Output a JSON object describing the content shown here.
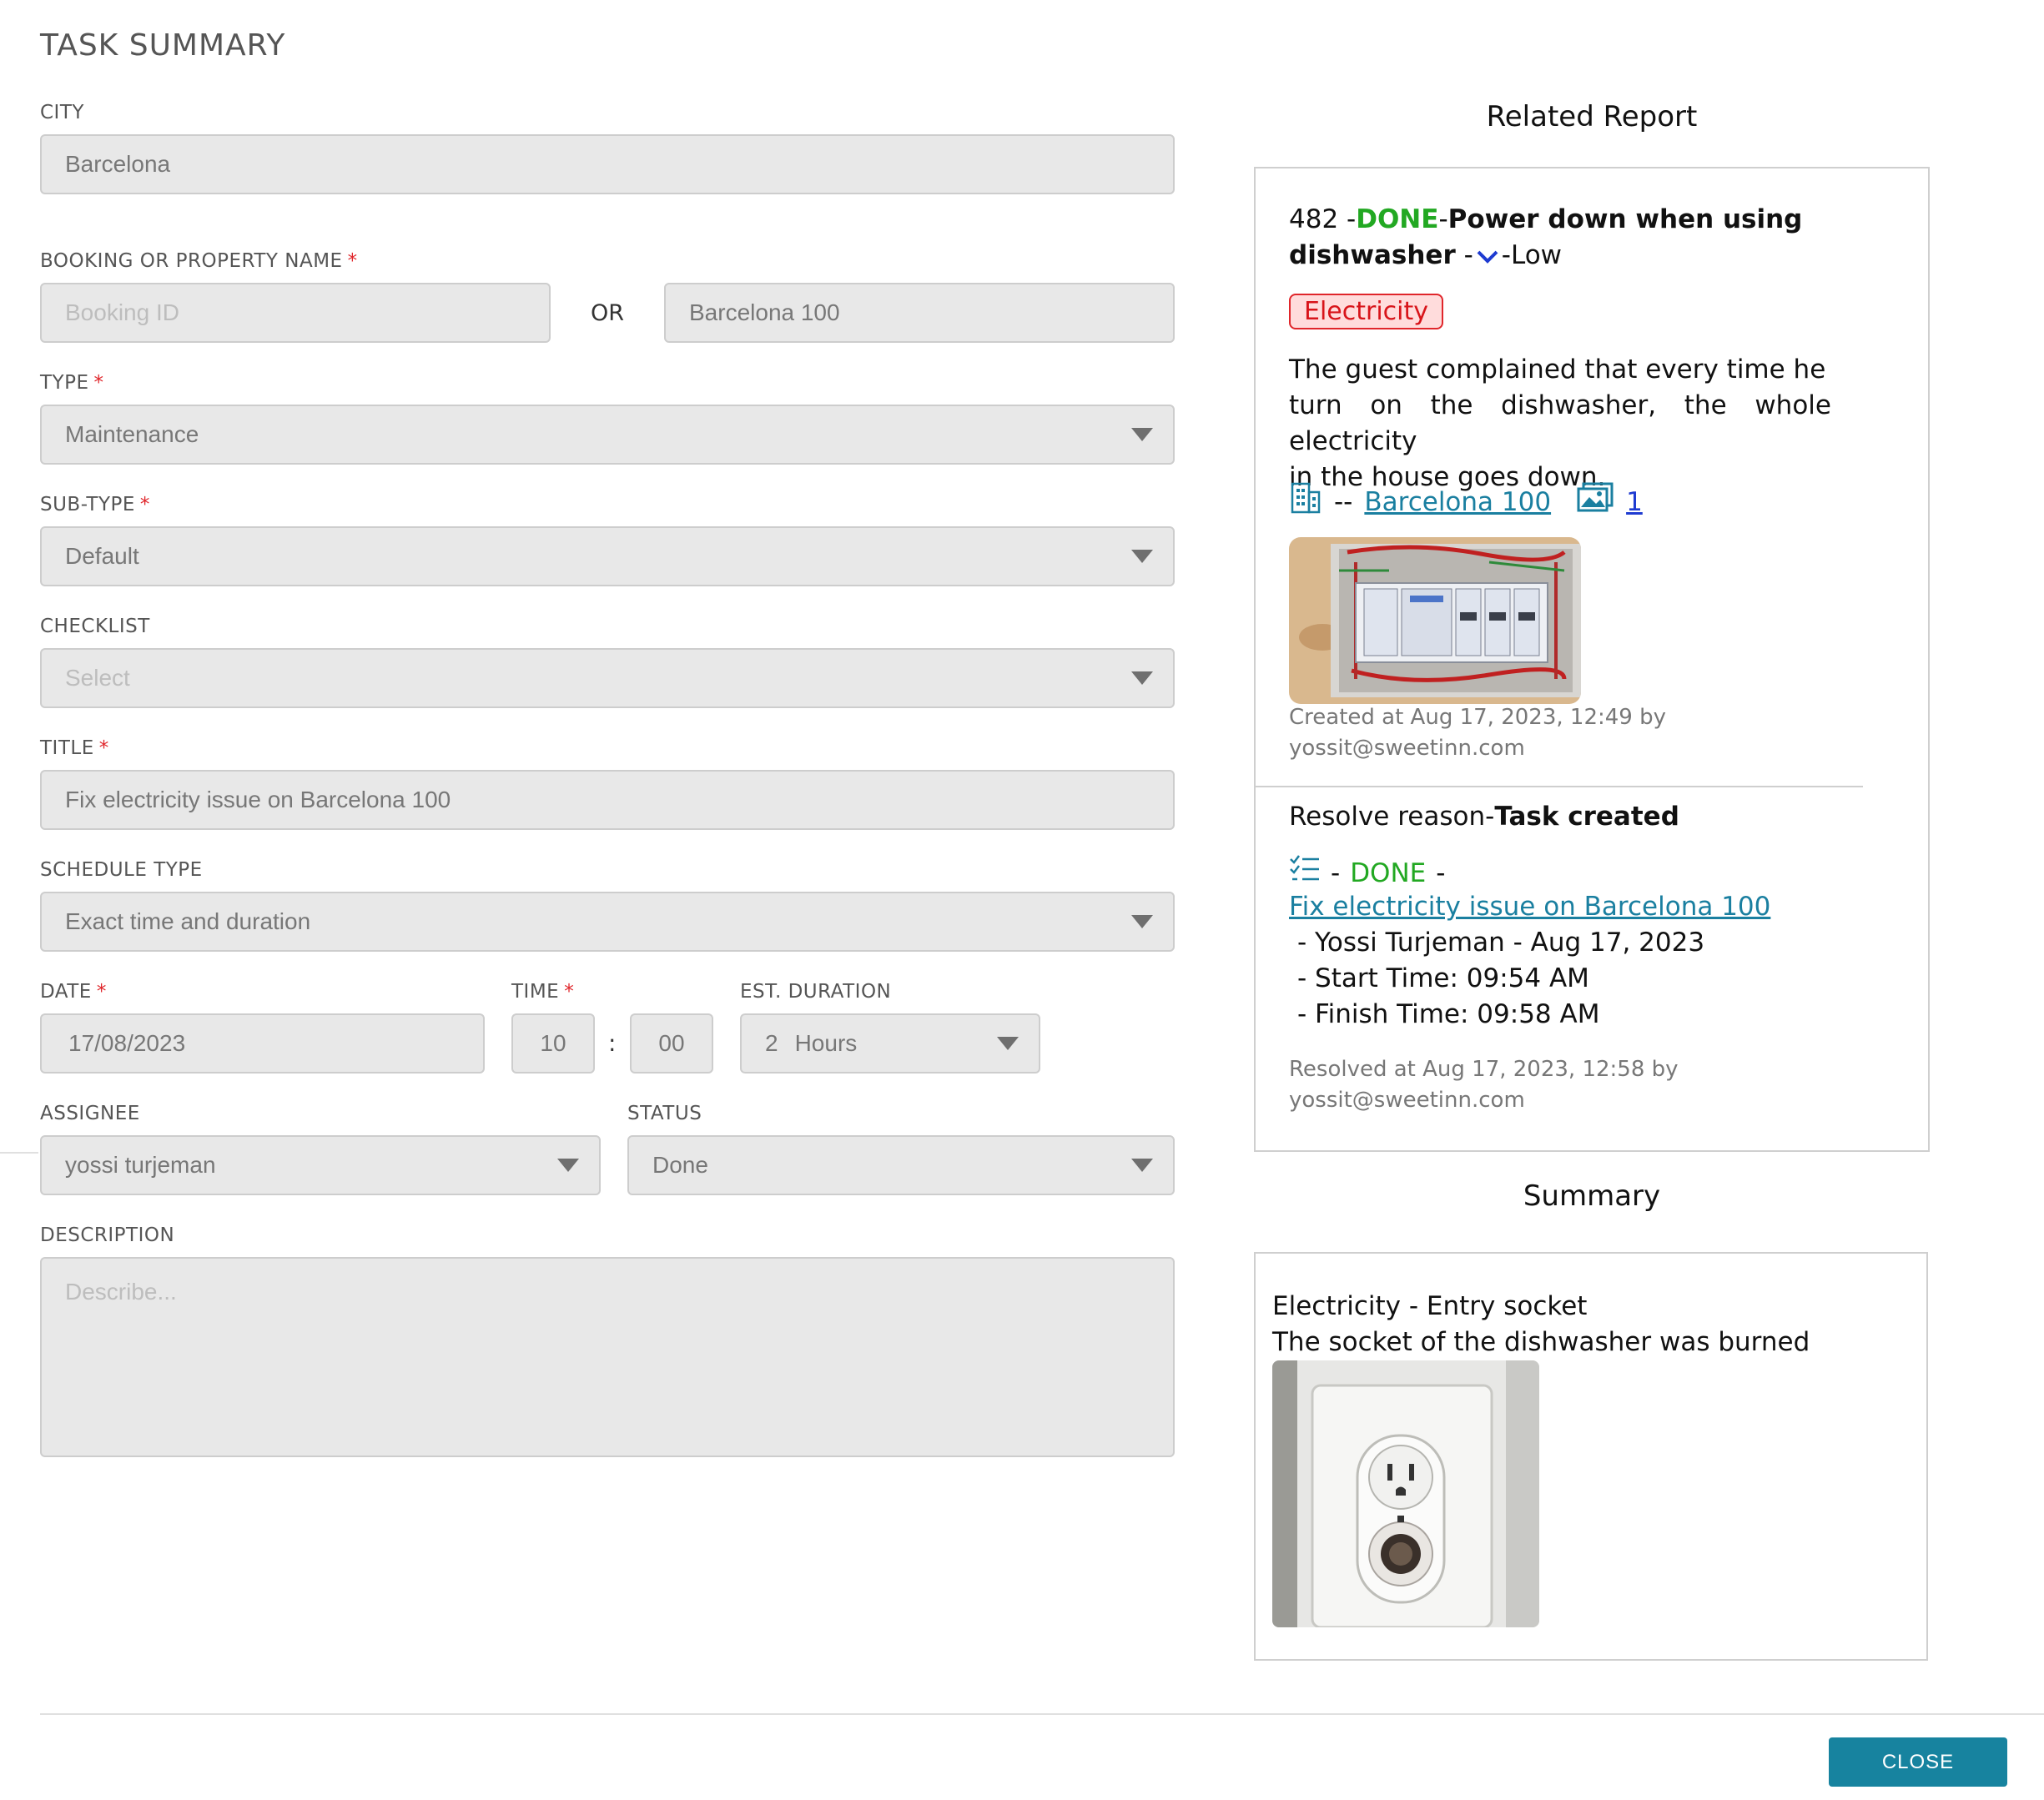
{
  "page": {
    "title": "TASK SUMMARY"
  },
  "form": {
    "city": {
      "label": "CITY",
      "value": "Barcelona"
    },
    "booking": {
      "label": "BOOKING OR PROPERTY NAME",
      "required": "*",
      "booking_placeholder": "Booking ID",
      "or_label": "OR",
      "property_value": "Barcelona 100"
    },
    "type": {
      "label": "TYPE",
      "required": "*",
      "value": "Maintenance"
    },
    "subtype": {
      "label": "SUB-TYPE",
      "required": "*",
      "value": "Default"
    },
    "checklist": {
      "label": "CHECKLIST",
      "placeholder": "Select"
    },
    "title": {
      "label": "TITLE",
      "required": "*",
      "value": "Fix electricity issue on Barcelona 100"
    },
    "schedule_type": {
      "label": "SCHEDULE TYPE",
      "value": "Exact time and duration"
    },
    "date": {
      "label": "DATE",
      "required": "*",
      "value": "17/08/2023"
    },
    "time": {
      "label": "TIME",
      "required": "*",
      "hour": "10",
      "separator": ":",
      "minute": "00"
    },
    "duration": {
      "label": "EST. DURATION",
      "amount": "2",
      "unit": "Hours"
    },
    "assignee": {
      "label": "ASSIGNEE",
      "value": "yossi turjeman"
    },
    "status": {
      "label": "STATUS",
      "value": "Done"
    },
    "description": {
      "label": "DESCRIPTION",
      "placeholder": "Describe..."
    }
  },
  "related_report": {
    "heading": "Related Report",
    "id": "482",
    "sep1": "-",
    "status": "DONE",
    "sep2": "-",
    "title_line1": "Power down when using",
    "title_line2": "dishwasher",
    "sep3": "-",
    "sep4": "-",
    "priority": "Low",
    "tag": "Electricity",
    "description_lines": [
      "The guest complained that every time he",
      "turn on the dishwasher, the whole electricity",
      "in the house goes down."
    ],
    "location_sep": "--",
    "property_link": "Barcelona 100",
    "photo_count": "1",
    "created_line1": "Created at Aug 17, 2023, 12:49 by",
    "created_line2": "yossit@sweetinn.com",
    "resolve_prefix": "Resolve reason-",
    "resolve_reason": "Task created",
    "task_sep1": "-",
    "task_status": "DONE",
    "task_sep2": "-",
    "task_link": "Fix electricity issue on Barcelona 100",
    "task_details": [
      "- Yossi Turjeman - Aug 17, 2023",
      "- Start Time: 09:54 AM",
      "- Finish Time: 09:58 AM"
    ],
    "resolved_line1": "Resolved at Aug 17, 2023, 12:58 by",
    "resolved_line2": "yossit@sweetinn.com"
  },
  "summary": {
    "heading": "Summary",
    "line1": "Electricity - Entry socket",
    "line2": "The socket of the dishwasher was burned"
  },
  "footer": {
    "close_label": "CLOSE"
  },
  "colors": {
    "accent": "#17839f",
    "done_green": "#22a822",
    "required_red": "#e0262b",
    "field_bg": "#e8e8e8"
  },
  "icons": {
    "building": "building-icon",
    "gallery": "image-gallery-icon",
    "checklist": "checklist-icon",
    "priority": "chevron-down-icon"
  }
}
